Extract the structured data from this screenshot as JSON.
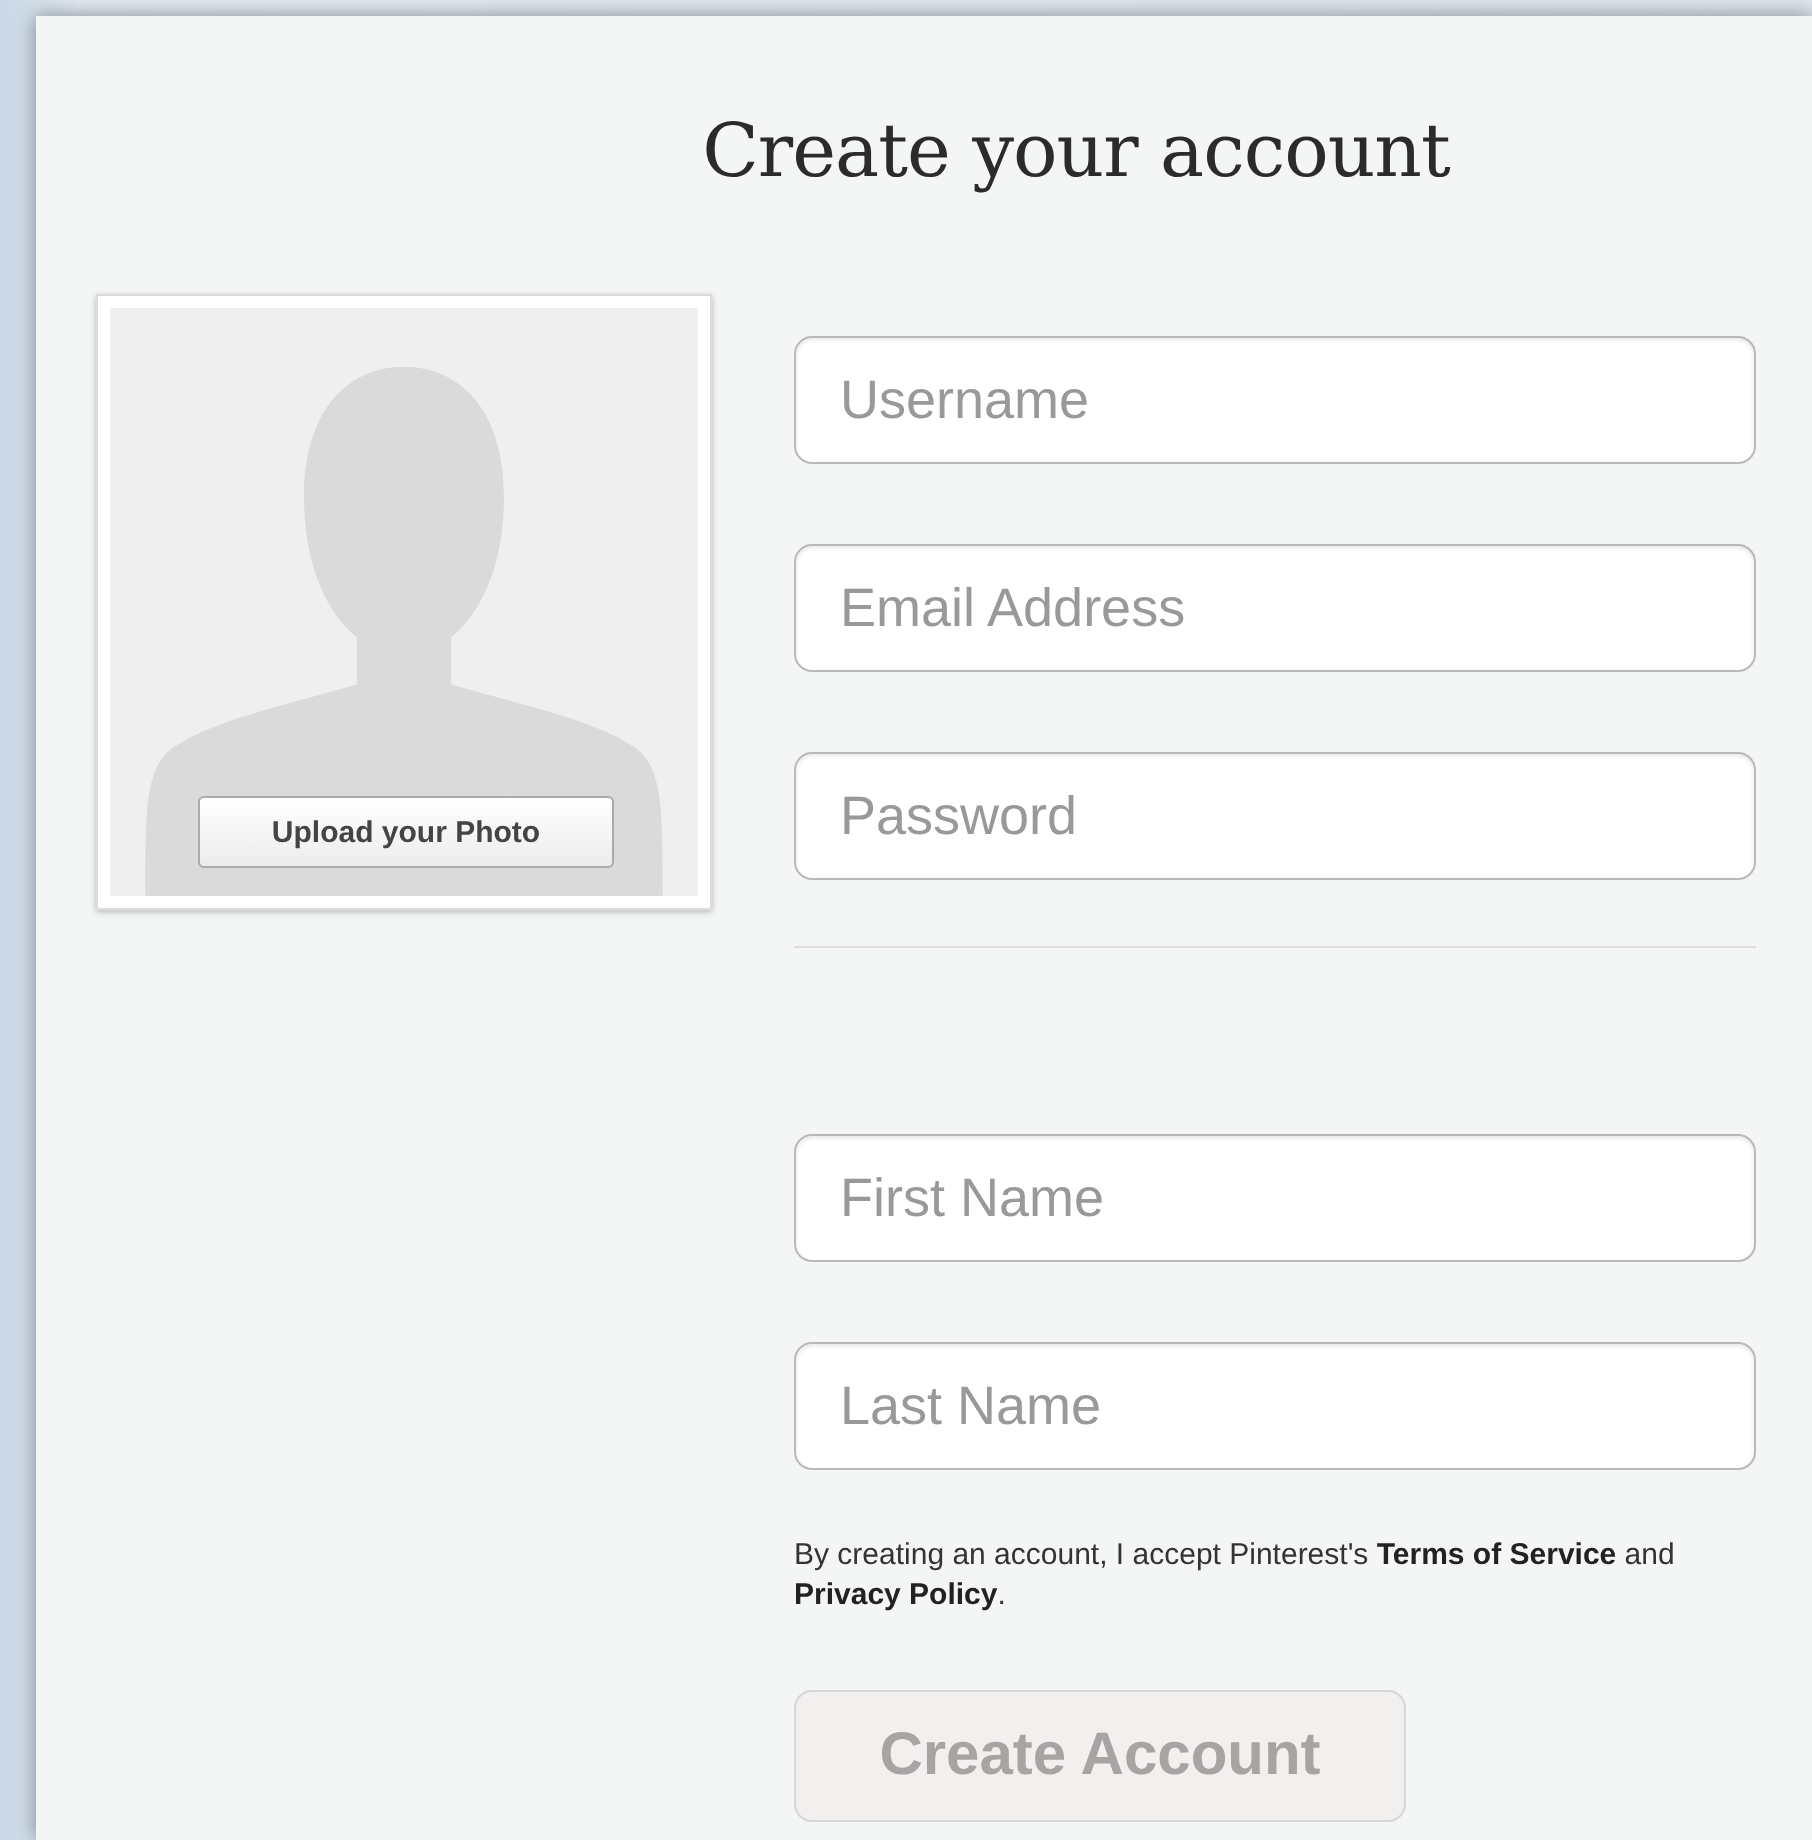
{
  "title": "Create your account",
  "photo": {
    "button": "Upload your Photo"
  },
  "account_fields": [
    {
      "placeholder": "Username"
    },
    {
      "placeholder": "Email Address"
    },
    {
      "placeholder": "Password"
    }
  ],
  "name_fields": [
    {
      "placeholder": "First Name"
    },
    {
      "placeholder": "Last Name"
    }
  ],
  "terms": {
    "before": "By creating an account, I accept Pinterest's ",
    "link_1": "Terms of Service",
    "middle": " and ",
    "link_2": "Privacy Policy",
    "after": "."
  },
  "submit": {
    "label": "Create Account",
    "disabled": true
  }
}
